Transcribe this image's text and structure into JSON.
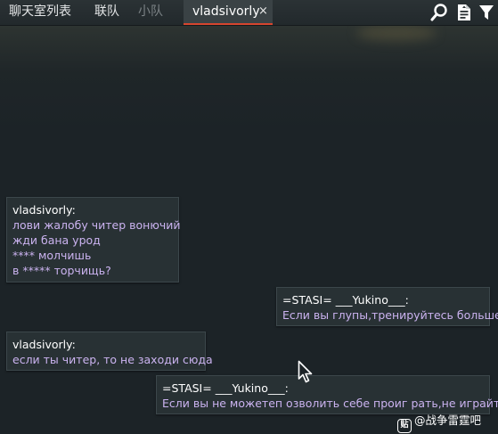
{
  "tabs": [
    {
      "label": "聊天室列表"
    },
    {
      "label": "联队"
    },
    {
      "label": "小队"
    },
    {
      "label": "vladsivorly",
      "close": "×"
    }
  ],
  "toolbar": {
    "icons": [
      "search-icon",
      "document-icon",
      "filter-icon"
    ]
  },
  "messages": [
    {
      "sender": "vladsivorly:",
      "lines": [
        "лови жалобу читер вонючий",
        "жди бана урод",
        "**** молчишь",
        "в ***** торчищь?"
      ]
    },
    {
      "sender": "=STASI= ___Yukino___:",
      "lines": [
        "Если вы глупы,тренируйтесь больше"
      ]
    },
    {
      "sender": "vladsivorly:",
      "lines": [
        "если ты читер, то не заходи сюда"
      ]
    },
    {
      "sender": "=STASI= ___Yukino___:",
      "lines": [
        "Если вы не можетеп озволить себе проиг рать,не играйте"
      ]
    }
  ],
  "watermark": {
    "logo": "贴",
    "text": "@战争雷霆吧"
  },
  "colors": {
    "background": "#1c2327",
    "bubble": "#283134",
    "message_text": "#cbb3f0",
    "active_tab_underline": "#d6452f"
  }
}
